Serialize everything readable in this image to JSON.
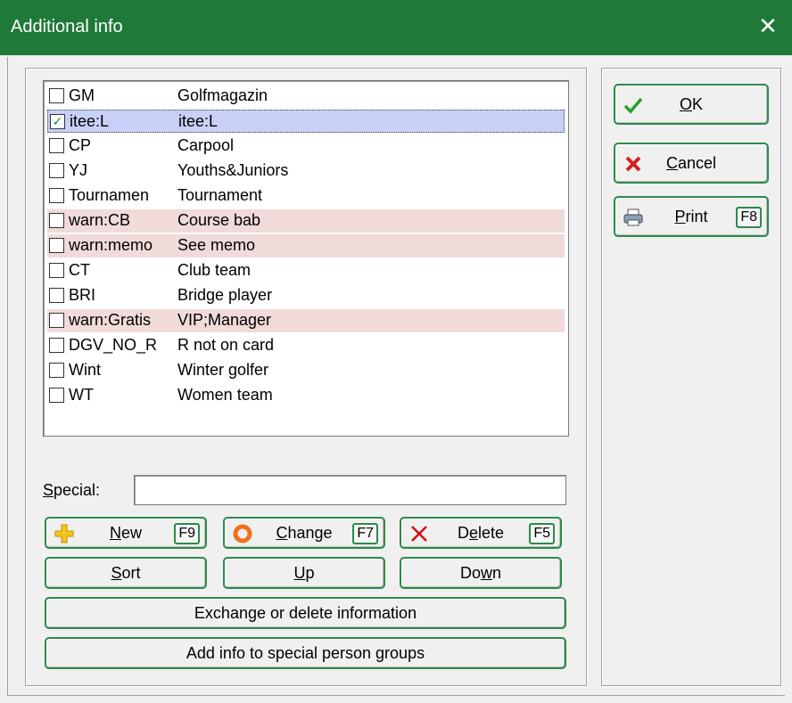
{
  "window": {
    "title": "Additional info",
    "close_glyph": "✕"
  },
  "list": {
    "items": [
      {
        "code": "GM",
        "desc": "Golfmagazin",
        "checked": false,
        "warn": false,
        "selected": false
      },
      {
        "code": "itee:L",
        "desc": "itee:L",
        "checked": true,
        "warn": false,
        "selected": true
      },
      {
        "code": "CP",
        "desc": "Carpool",
        "checked": false,
        "warn": false,
        "selected": false
      },
      {
        "code": "YJ",
        "desc": "Youths&Juniors",
        "checked": false,
        "warn": false,
        "selected": false
      },
      {
        "code": "Tournamen",
        "desc": "Tournament",
        "checked": false,
        "warn": false,
        "selected": false
      },
      {
        "code": "warn:CB",
        "desc": "Course bab",
        "checked": false,
        "warn": true,
        "selected": false
      },
      {
        "code": "warn:memo",
        "desc": "See memo",
        "checked": false,
        "warn": true,
        "selected": false
      },
      {
        "code": "CT",
        "desc": "Club team",
        "checked": false,
        "warn": false,
        "selected": false
      },
      {
        "code": "BRI",
        "desc": "Bridge player",
        "checked": false,
        "warn": false,
        "selected": false
      },
      {
        "code": "warn:Gratis",
        "desc": "VIP;Manager",
        "checked": false,
        "warn": true,
        "selected": false
      },
      {
        "code": "DGV_NO_R",
        "desc": "R not on card",
        "checked": false,
        "warn": false,
        "selected": false
      },
      {
        "code": "Wint",
        "desc": "Winter golfer",
        "checked": false,
        "warn": false,
        "selected": false
      },
      {
        "code": "WT",
        "desc": "Women team",
        "checked": false,
        "warn": false,
        "selected": false
      }
    ]
  },
  "special": {
    "label_first": "S",
    "label_rest": "pecial:",
    "value": ""
  },
  "buttons": {
    "ok": {
      "u": "O",
      "rest": "K"
    },
    "cancel": {
      "u": "C",
      "rest": "ancel"
    },
    "print": {
      "u": "P",
      "rest": "rint",
      "fkey": "F8"
    },
    "new": {
      "u": "N",
      "rest": "ew",
      "fkey": "F9"
    },
    "change": {
      "u": "C",
      "rest": "hange",
      "fkey": "F7"
    },
    "delete": {
      "pre": "D",
      "u": "e",
      "rest": "lete",
      "fkey": "F5"
    },
    "sort": {
      "u": "S",
      "rest": "ort"
    },
    "up": {
      "u": "U",
      "rest": "p"
    },
    "down": {
      "pre": "Do",
      "u": "w",
      "rest": "n"
    },
    "exchange": "Exchange or delete information",
    "addinfo": "Add info to special person groups"
  },
  "colors": {
    "titlebar": "#1f7a39",
    "warn_row": "#f1dada",
    "selected_row": "#c8d0f8",
    "button_border": "#2c8a4a"
  }
}
